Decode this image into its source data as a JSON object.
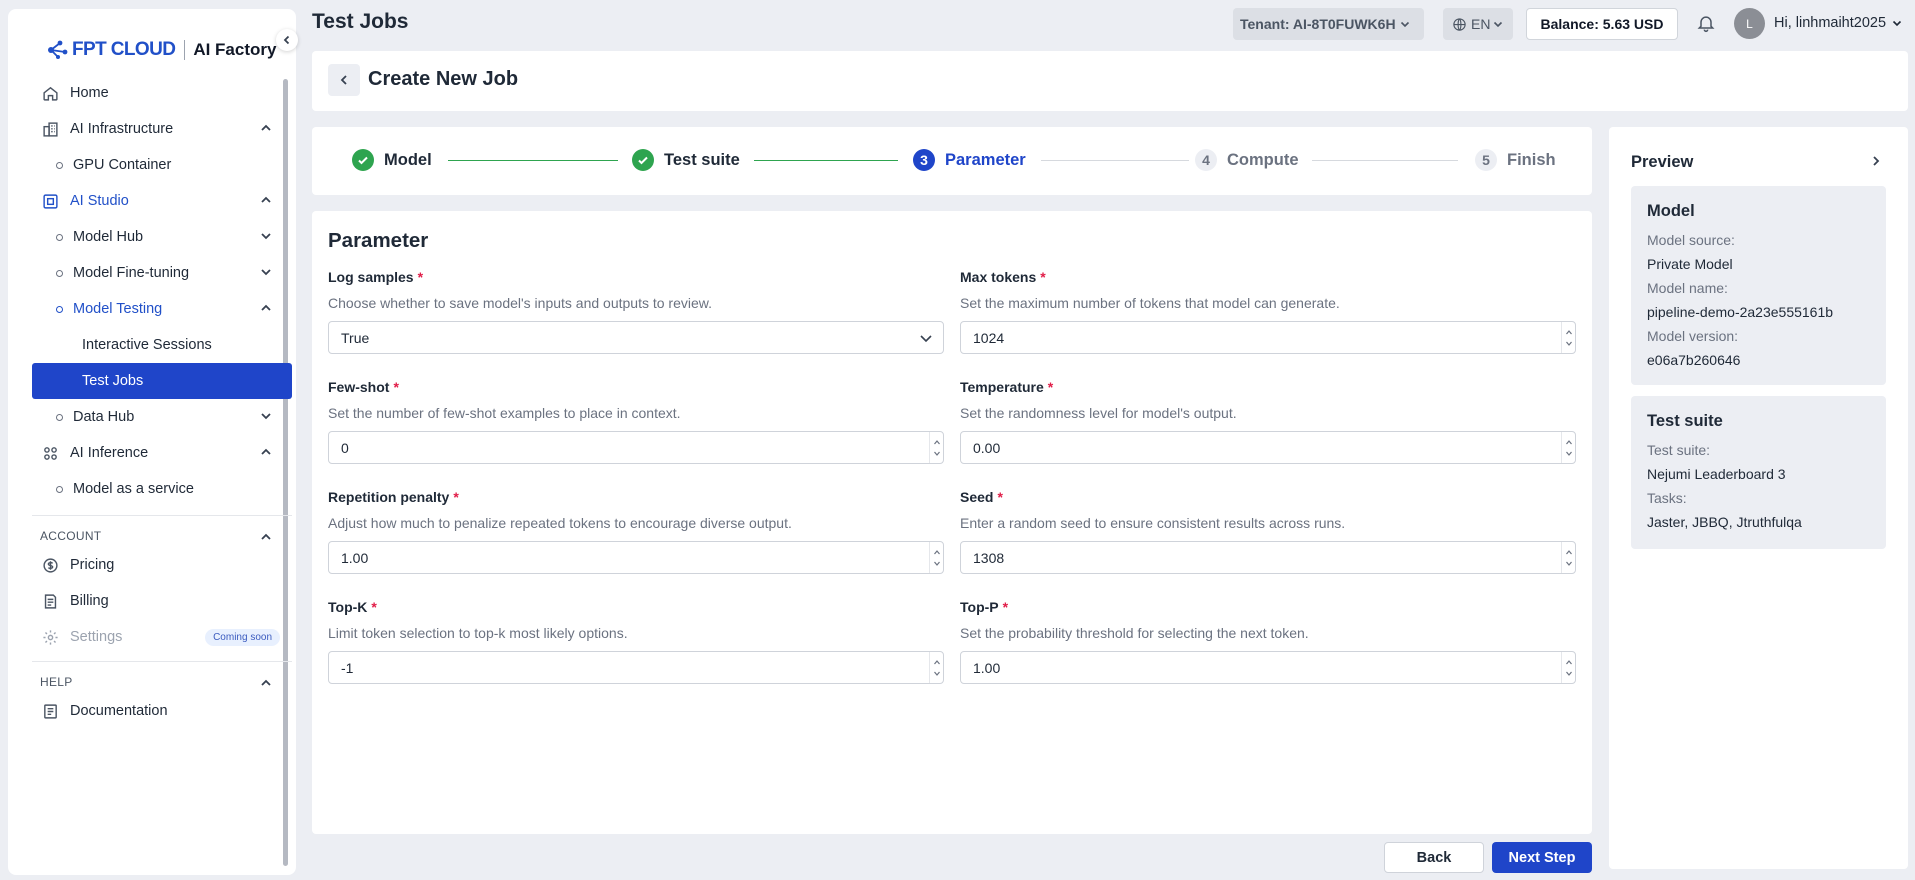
{
  "app": {
    "brand": "FPT CLOUD",
    "product": "AI Factory",
    "page_title": "Test Jobs"
  },
  "topbar": {
    "tenant": "Tenant: AI-8T0FUWK6H",
    "language": "EN",
    "balance": "Balance: 5.63 USD",
    "avatar_initial": "L",
    "greeting": "Hi, linhmaiht2025"
  },
  "sidebar": {
    "home": "Home",
    "ai_infrastructure": "AI Infrastructure",
    "gpu_container": "GPU Container",
    "ai_studio": "AI Studio",
    "model_hub": "Model Hub",
    "model_fine_tuning": "Model Fine-tuning",
    "model_testing": "Model Testing",
    "interactive_sessions": "Interactive Sessions",
    "test_jobs": "Test Jobs",
    "data_hub": "Data Hub",
    "ai_inference": "AI Inference",
    "model_as_a_service": "Model as a service",
    "account_header": "ACCOUNT",
    "pricing": "Pricing",
    "billing": "Billing",
    "settings": "Settings",
    "coming_soon": "Coming soon",
    "help_header": "HELP",
    "documentation": "Documentation"
  },
  "header": {
    "create_title": "Create New Job"
  },
  "stepper": {
    "steps": [
      {
        "number": "1",
        "label": "Model",
        "status": "done"
      },
      {
        "number": "2",
        "label": "Test suite",
        "status": "done"
      },
      {
        "number": "3",
        "label": "Parameter",
        "status": "current"
      },
      {
        "number": "4",
        "label": "Compute",
        "status": "todo"
      },
      {
        "number": "5",
        "label": "Finish",
        "status": "todo"
      }
    ]
  },
  "form": {
    "title": "Parameter",
    "fields": {
      "log_samples": {
        "label": "Log samples",
        "description": "Choose whether to save model's inputs and outputs to review.",
        "value": "True"
      },
      "max_tokens": {
        "label": "Max tokens",
        "description": "Set the maximum number of tokens that model can generate.",
        "value": "1024"
      },
      "few_shot": {
        "label": "Few-shot",
        "description": "Set the number of few-shot examples to place in context.",
        "value": "0"
      },
      "temperature": {
        "label": "Temperature",
        "description": "Set the randomness level for model's output.",
        "value": "0.00"
      },
      "repetition_penalty": {
        "label": "Repetition penalty",
        "description": "Adjust how much to penalize repeated tokens to encourage diverse output.",
        "value": "1.00"
      },
      "seed": {
        "label": "Seed",
        "description": "Enter a random seed to ensure consistent results across runs.",
        "value": "1308"
      },
      "top_k": {
        "label": "Top-K",
        "description": "Limit token selection to top-k most likely options.",
        "value": "-1"
      },
      "top_p": {
        "label": "Top-P",
        "description": "Set the probability threshold for selecting the next token.",
        "value": "1.00"
      }
    },
    "required_mark": "*"
  },
  "preview": {
    "title": "Preview",
    "model": {
      "heading": "Model",
      "source_label": "Model source:",
      "source": "Private Model",
      "name_label": "Model name:",
      "name": "pipeline-demo-2a23e555161b",
      "version_label": "Model version:",
      "version": "e06a7b260646"
    },
    "test_suite": {
      "heading": "Test suite",
      "suite_label": "Test suite:",
      "suite": "Nejumi Leaderboard 3",
      "tasks_label": "Tasks:",
      "tasks": "Jaster, JBBQ, Jtruthfulqa"
    }
  },
  "actions": {
    "back": "Back",
    "next": "Next Step"
  },
  "colors": {
    "primary": "#1f45c9",
    "success": "#2ea44f",
    "required": "#e11d48",
    "brand": "#2150c8"
  }
}
